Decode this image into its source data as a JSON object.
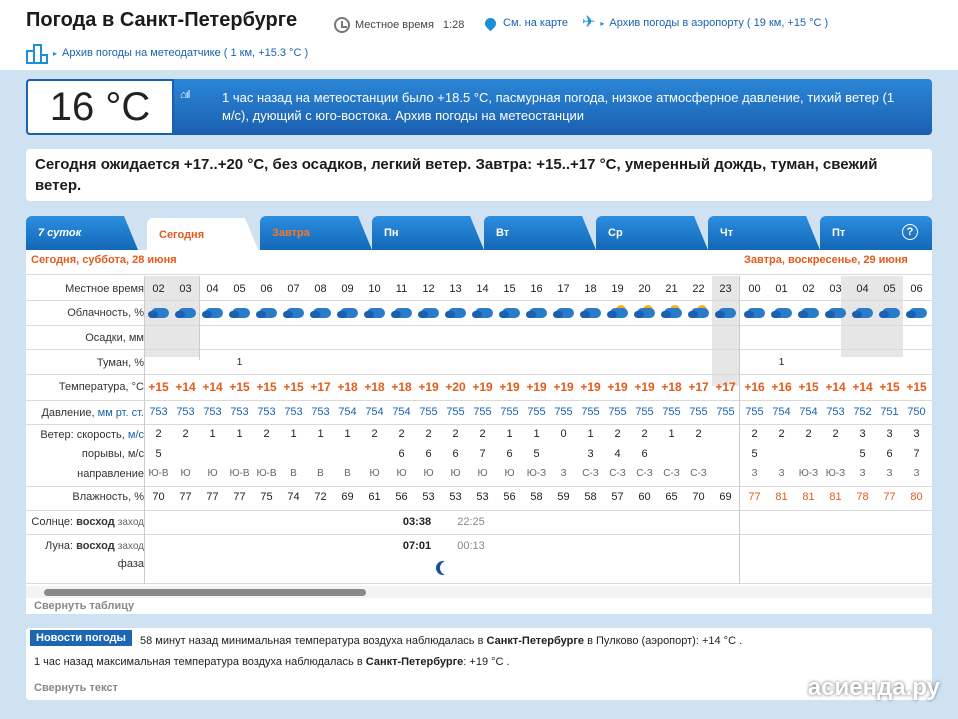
{
  "header": {
    "title": "Погода в Санкт-Петербурге",
    "local_time_label": "Местное время",
    "local_time": "1:28",
    "map_link": "См. на карте",
    "airport_link": "Архив погоды в аэропорту ( 19 км, +15 °C )",
    "station_link": "Архив погоды на метеодатчике ( 1 км, +15.3 °C )"
  },
  "current": {
    "temp": "16 °C",
    "text": "1 час назад на метеостанции было +18.5 °C, пасмурная погода, низкое атмосферное давление, тихий ветер (1 м/с), дующий с юго-востока. Архив погоды на метеостанции"
  },
  "forecast": "Сегодня ожидается +17..+20 °C, без осадков, легкий ветер. Завтра: +15..+17 °C, умеренный дождь, туман, свежий ветер.",
  "tabs": [
    "7 суток",
    "Сегодня",
    "Завтра",
    "Пн",
    "Вт",
    "Ср",
    "Чт",
    "Пт"
  ],
  "help": "?",
  "days": {
    "today": "Сегодня, суббота, 28 июня",
    "tomorrow": "Завтра, воскресенье, 29 июня"
  },
  "labels": {
    "time": "Местное время",
    "clouds": "Облачность, %",
    "precip": "Осадки, мм",
    "fog": "Туман, %",
    "temp": "Температура, °C",
    "pressure": "Давление,",
    "pressure_unit": "мм рт. ст.",
    "wind": "Ветер: скорость,",
    "wind_unit": "м/с",
    "gusts": "порывы, м/с",
    "dir": "направление",
    "hum": "Влажность, %",
    "sun_a": "Солнце:",
    "sun_b": "восход",
    "sun_c": "заход",
    "moon_a": "Луна:",
    "moon_b": "восход",
    "moon_c": "заход",
    "phase": "фаза"
  },
  "hours": [
    "02",
    "03",
    "04",
    "05",
    "06",
    "07",
    "08",
    "09",
    "10",
    "11",
    "12",
    "13",
    "14",
    "15",
    "16",
    "17",
    "18",
    "19",
    "20",
    "21",
    "22",
    "23",
    "00",
    "01",
    "02",
    "03",
    "04",
    "05",
    "06"
  ],
  "fog_vals": {
    "3": "1",
    "23": "1"
  },
  "temps": [
    "+15",
    "+14",
    "+14",
    "+15",
    "+15",
    "+15",
    "+17",
    "+18",
    "+18",
    "+18",
    "+19",
    "+20",
    "+19",
    "+19",
    "+19",
    "+19",
    "+19",
    "+19",
    "+19",
    "+18",
    "+17",
    "+17",
    "+16",
    "+16",
    "+15",
    "+14",
    "+14",
    "+15",
    "+15"
  ],
  "pressure": [
    "753",
    "753",
    "753",
    "753",
    "753",
    "753",
    "753",
    "754",
    "754",
    "754",
    "755",
    "755",
    "755",
    "755",
    "755",
    "755",
    "755",
    "755",
    "755",
    "755",
    "755",
    "755",
    "755",
    "754",
    "754",
    "753",
    "752",
    "751",
    "750"
  ],
  "wind": [
    "2",
    "2",
    "1",
    "1",
    "2",
    "1",
    "1",
    "1",
    "2",
    "2",
    "2",
    "2",
    "2",
    "1",
    "1",
    "0",
    "1",
    "2",
    "2",
    "1",
    "2",
    "",
    "2",
    "2",
    "2",
    "2",
    "3",
    "3",
    "3"
  ],
  "gusts": [
    "5",
    "",
    "",
    "",
    "",
    "",
    "",
    "",
    "",
    "6",
    "6",
    "6",
    "7",
    "6",
    "5",
    "",
    "3",
    "4",
    "6",
    "",
    "",
    "",
    "5",
    "",
    "",
    "",
    "5",
    "6",
    "7"
  ],
  "dirs": [
    "Ю-В",
    "Ю",
    "Ю",
    "Ю-В",
    "Ю-В",
    "В",
    "В",
    "В",
    "Ю",
    "Ю",
    "Ю",
    "Ю",
    "Ю",
    "Ю",
    "Ю-З",
    "З",
    "С-З",
    "С-З",
    "С-З",
    "С-З",
    "С-З",
    "",
    "З",
    "З",
    "Ю-З",
    "Ю-З",
    "З",
    "З",
    "З"
  ],
  "hums": [
    "70",
    "77",
    "77",
    "77",
    "75",
    "74",
    "72",
    "69",
    "61",
    "56",
    "53",
    "53",
    "53",
    "56",
    "58",
    "59",
    "58",
    "57",
    "60",
    "65",
    "70",
    "69",
    "77",
    "81",
    "81",
    "81",
    "78",
    "77",
    "80"
  ],
  "sunrise": "03:38",
  "sunset": "22:25",
  "moonrise": "07:01",
  "moonset": "00:13",
  "collapse_table": "Свернуть таблицу",
  "news": {
    "tag": "Новости погоды",
    "l1a": "58 минут назад минимальная температура воздуха наблюдалась в",
    "l1b": "Санкт-Петербурге",
    "l1c": "в Пулково (аэропорт): +14 °C .",
    "l2a": "1 час назад максимальная температура воздуха наблюдалась в",
    "l2b": "Санкт-Петербурге",
    "l2c": ": +19 °C .",
    "collapse": "Свернуть текст"
  },
  "watermark": "асиенда.ру",
  "colors": {
    "accent": "#e45a1a",
    "blue": "#1a5fb0"
  }
}
